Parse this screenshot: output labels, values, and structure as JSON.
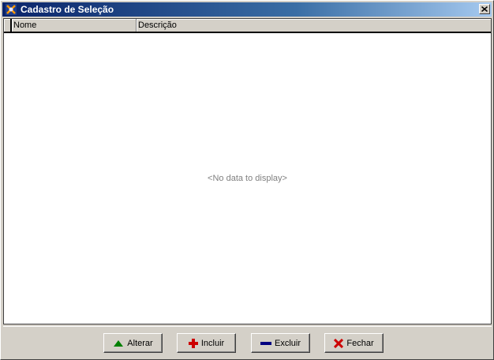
{
  "window": {
    "title": "Cadastro de Seleção",
    "close_glyph": "✕"
  },
  "grid": {
    "columns": [
      "Nome",
      "Descrição"
    ],
    "empty_text": "<No data to display>"
  },
  "buttons": {
    "alterar": {
      "label": "Alterar",
      "icon": "triangle-up-icon",
      "color": "#008000"
    },
    "incluir": {
      "label": "Incluir",
      "icon": "plus-icon",
      "color": "#cc0000"
    },
    "excluir": {
      "label": "Excluir",
      "icon": "minus-icon",
      "color": "#000080"
    },
    "fechar": {
      "label": "Fechar",
      "icon": "x-icon",
      "color": "#cc0000"
    }
  },
  "colors": {
    "titlebar_start": "#0a246a",
    "titlebar_end": "#a6caf0",
    "face": "#d4d0c8"
  }
}
